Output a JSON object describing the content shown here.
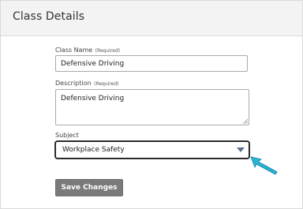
{
  "card": {
    "title": "Class Details"
  },
  "form": {
    "class_name": {
      "label": "Class Name",
      "required": "(Required)",
      "value": "Defensive Driving"
    },
    "description": {
      "label": "Description",
      "required": "(Required)",
      "value": "Defensive Driving"
    },
    "subject": {
      "label": "Subject",
      "selected": "Workplace Safety"
    },
    "save_label": "Save Changes"
  },
  "colors": {
    "header_bg": "#f3f3f3",
    "button_bg": "#7a7a7a",
    "pointer_arrow": "#2bb3d6"
  }
}
